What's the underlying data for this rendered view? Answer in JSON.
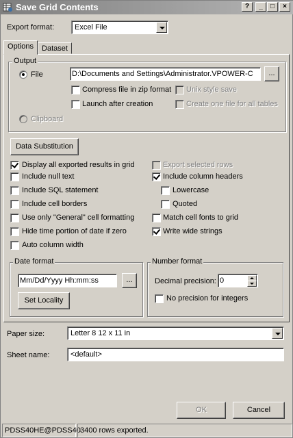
{
  "window": {
    "title": "Save Grid Contents",
    "controls": [
      "?",
      "_",
      "□",
      "×"
    ]
  },
  "export_format": {
    "label": "Export format:",
    "value": "Excel File"
  },
  "tabs": [
    {
      "label": "Options",
      "active": true
    },
    {
      "label": "Dataset",
      "active": false
    }
  ],
  "output": {
    "group_label": "Output",
    "file_label": "File",
    "file_path": "D:\\Documents and Settings\\Administrator.VPOWER-C",
    "browse_label": "...",
    "compress_label": "Compress file in zip format",
    "unix_label": "Unix style save",
    "launch_label": "Launch after creation",
    "one_file_label": "Create one file for all tables",
    "clipboard_label": "Clipboard"
  },
  "data_substitution_label": "Data Substitution",
  "options_left": [
    {
      "label": "Display all exported results in grid",
      "checked": true
    },
    {
      "label": "Include null text",
      "checked": false
    },
    {
      "label": "Include SQL statement",
      "checked": false
    },
    {
      "label": "Include cell borders",
      "checked": false
    },
    {
      "label": "Use only \"General\" cell formatting",
      "checked": false
    },
    {
      "label": "Hide time portion of date if zero",
      "checked": false
    },
    {
      "label": "Auto column width",
      "checked": false
    }
  ],
  "options_right": {
    "export_selected": "Export selected rows",
    "include_headers": "Include column headers",
    "lowercase": "Lowercase",
    "quoted": "Quoted",
    "match_fonts": "Match cell fonts to grid",
    "write_wide": "Write wide strings"
  },
  "date_format": {
    "group_label": "Date format",
    "value": "Mm/Dd/Yyyy Hh:mm:ss",
    "browse_label": "...",
    "set_locality_label": "Set Locality"
  },
  "number_format": {
    "group_label": "Number format",
    "decimal_label": "Decimal precision:",
    "decimal_value": "0",
    "no_precision_label": "No precision for integers"
  },
  "paper_size": {
    "label": "Paper size:",
    "value": "Letter 8 12 x 11 in"
  },
  "sheet_name": {
    "label": "Sheet name:",
    "value": "<default>"
  },
  "buttons": {
    "ok": "OK",
    "cancel": "Cancel"
  },
  "status": {
    "connection": "PDSS40HE@PDSS40",
    "message": "3400 rows exported."
  }
}
